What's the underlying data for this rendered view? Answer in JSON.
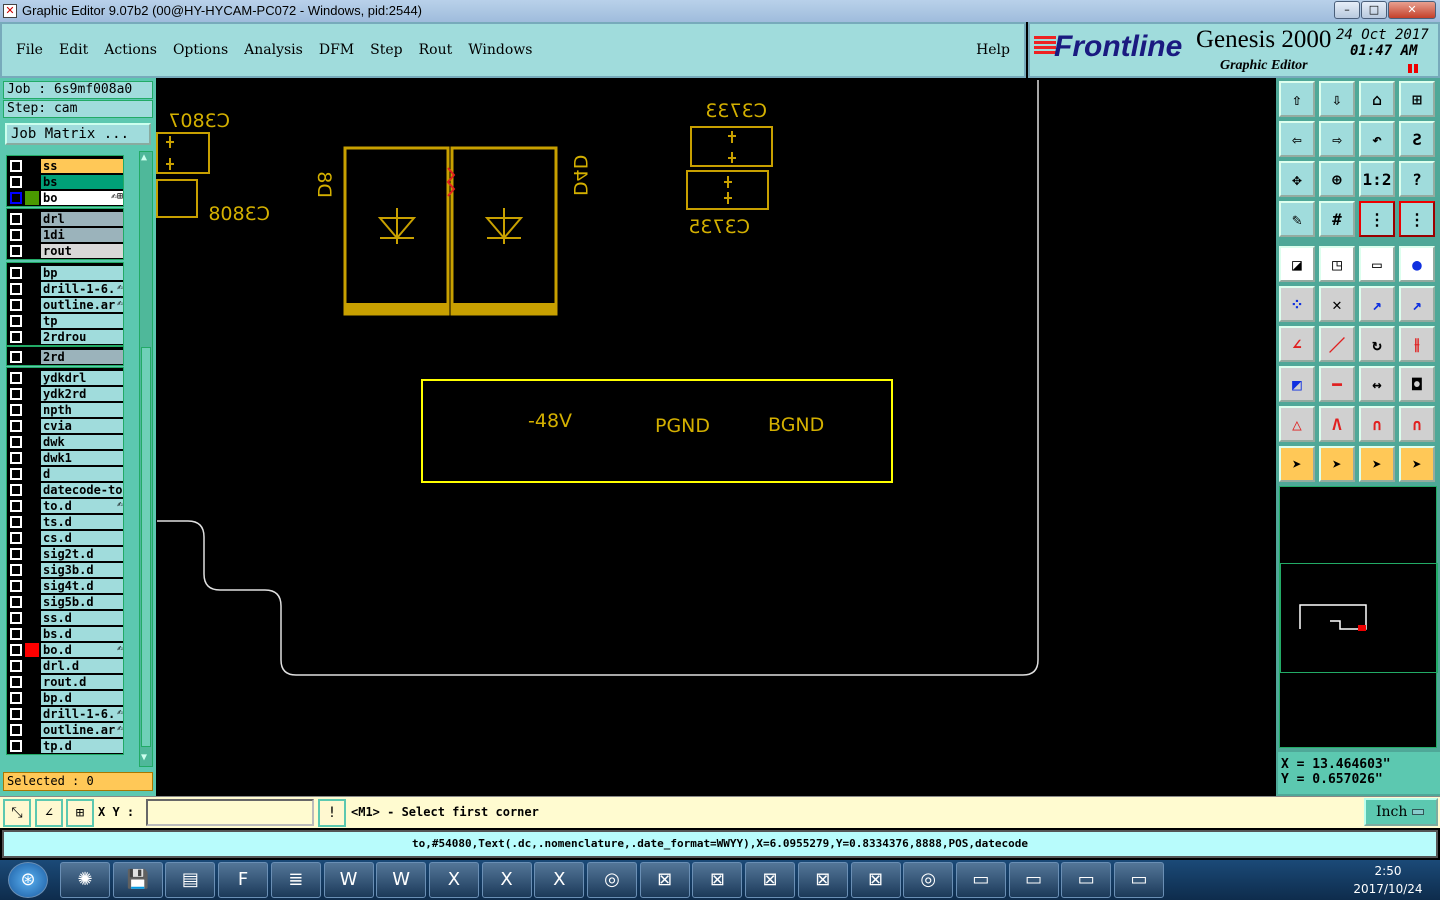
{
  "window": {
    "title": "Graphic Editor 9.07b2 (00@HY-HYCAM-PC072 - Windows, pid:2544)",
    "minimize": "–",
    "maximize": "□",
    "close": "✕"
  },
  "menu": [
    "File",
    "Edit",
    "Actions",
    "Options",
    "Analysis",
    "DFM",
    "Step",
    "Rout",
    "Windows"
  ],
  "help": "Help",
  "brand": {
    "logo": "Frontline",
    "product": "Genesis 2000",
    "subtitle": "Graphic Editor",
    "date": "24 Oct 2017",
    "time": "01:47 AM"
  },
  "job": {
    "job_label": "Job  :  6s9mf008a0",
    "step_label": "Step: cam",
    "matrix_button": "Job Matrix ..."
  },
  "layer_groups": [
    [
      {
        "name": "ss",
        "color": "#ffc857"
      },
      {
        "name": "bs",
        "color": "#00a078"
      },
      {
        "name": "bo",
        "color": "#ffffff",
        "swatch": "#4a9a00",
        "active": true,
        "icons": "✍⊞"
      }
    ],
    [
      {
        "name": "drl",
        "color": "#9bb3bb"
      },
      {
        "name": "1di",
        "color": "#9bb3bb"
      },
      {
        "name": "rout",
        "color": "#d8d8d8"
      }
    ],
    [
      {
        "name": "bp",
        "color": "#a0dcdc"
      },
      {
        "name": "drill-1-6.",
        "color": "#a0dcdc",
        "icons": "✍"
      },
      {
        "name": "outline.ar",
        "color": "#a0dcdc",
        "icons": "✍"
      },
      {
        "name": "tp",
        "color": "#a0dcdc"
      },
      {
        "name": "2rdrou",
        "color": "#a0dcdc"
      }
    ],
    [
      {
        "name": "2rd",
        "color": "#9bb3bb"
      }
    ],
    [
      {
        "name": "ydkdrl"
      },
      {
        "name": "ydk2rd"
      },
      {
        "name": "npth"
      },
      {
        "name": "cvia"
      },
      {
        "name": "dwk"
      },
      {
        "name": "dwk1"
      },
      {
        "name": "d"
      },
      {
        "name": "datecode-to"
      },
      {
        "name": "to.d",
        "icons": "✍"
      },
      {
        "name": "ts.d"
      },
      {
        "name": "cs.d"
      },
      {
        "name": "sig2t.d"
      },
      {
        "name": "sig3b.d"
      },
      {
        "name": "sig4t.d"
      },
      {
        "name": "sig5b.d"
      },
      {
        "name": "ss.d"
      },
      {
        "name": "bs.d"
      },
      {
        "name": "bo.d",
        "swatch": "#ff0000",
        "icons": "✍"
      },
      {
        "name": "drl.d"
      },
      {
        "name": "rout.d"
      },
      {
        "name": "bp.d"
      },
      {
        "name": "drill-1-6.",
        "icons": "✍"
      },
      {
        "name": "outline.ar",
        "icons": "✍"
      },
      {
        "name": "tp.d"
      }
    ]
  ],
  "selected": "Selected : 0",
  "canvas": {
    "labels_mirrored": [
      "C3807",
      "C3808",
      "C3733",
      "C3735",
      "D8",
      "D4D"
    ],
    "labels": [
      "-48V",
      "PGND",
      "BGND"
    ],
    "feature_color": "#c8a000",
    "text_color": "#d4b000",
    "box_color": "#ffff00"
  },
  "toolbar_icons": [
    "pan-up",
    "pan-down",
    "home",
    "xy-window",
    "pan-left",
    "pan-right",
    "undo-view",
    "snap",
    "zoom-out",
    "zoom-in",
    "scale-1-2",
    "help",
    "tools",
    "grid",
    "route-layer",
    "route-layer-red",
    "measure-select",
    "move-window",
    "ruler",
    "pad",
    "connect",
    "delete",
    "move-point",
    "move-point-filled",
    "line-angle",
    "line-segment",
    "rotate",
    "mirror",
    "move-pad",
    "line-center",
    "dimension",
    "overlap",
    "arc-triangle",
    "arc-a",
    "arc-bridge",
    "arc-bridge-x",
    "pointer",
    "pointer-box",
    "pointer-poly",
    "pointer-route"
  ],
  "toolbar_labels": {
    "scale": "1:2",
    "help": "?"
  },
  "coords": {
    "x": "X  =  13.464603\"",
    "y": "Y  =  0.657026\""
  },
  "command": {
    "xy_label": "X Y :",
    "xy_value": "",
    "warn": "!",
    "prompt": "<M1> - Select first corner",
    "unit": "Inch"
  },
  "status": "to,#54080,Text(.dc,.nomenclature,.date_format=WWYY),X=6.0955279,Y=0.8334376,8888,POS,datecode",
  "taskbar": {
    "time": "2:50",
    "date": "2017/10/24",
    "apps": [
      "start",
      "shell",
      "save",
      "scanner",
      "frontline",
      "notepad",
      "word",
      "word",
      "excel",
      "excel",
      "excel",
      "disc",
      "genesis",
      "genesis",
      "genesis",
      "genesis",
      "genesis",
      "disc2",
      "window",
      "window",
      "window",
      "window"
    ]
  }
}
